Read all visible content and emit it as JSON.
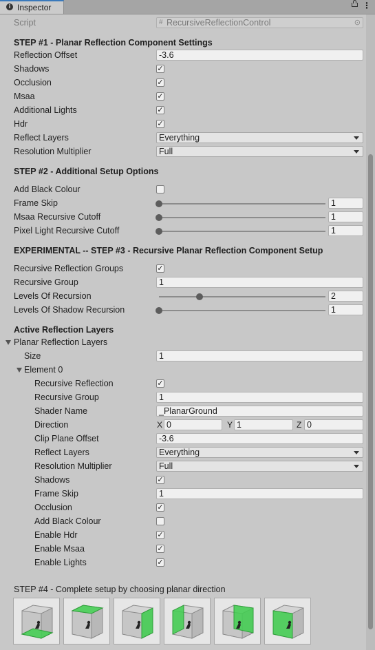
{
  "window": {
    "tab_title": "Inspector"
  },
  "script": {
    "label": "Script",
    "value": "RecursiveReflectionControl"
  },
  "step1": {
    "title": "STEP #1 - Planar Reflection Component Settings",
    "reflection_offset": {
      "label": "Reflection Offset",
      "value": "-3.6"
    },
    "shadows": {
      "label": "Shadows",
      "checked": true
    },
    "occlusion": {
      "label": "Occlusion",
      "checked": true
    },
    "msaa": {
      "label": "Msaa",
      "checked": true
    },
    "additional_lights": {
      "label": "Additional Lights",
      "checked": true
    },
    "hdr": {
      "label": "Hdr",
      "checked": true
    },
    "reflect_layers": {
      "label": "Reflect Layers",
      "value": "Everything"
    },
    "resolution_multiplier": {
      "label": "Resolution Multiplier",
      "value": "Full"
    }
  },
  "step2": {
    "title": "STEP #2 - Additional Setup Options",
    "add_black_colour": {
      "label": "Add Black Colour",
      "checked": false
    },
    "frame_skip": {
      "label": "Frame Skip",
      "value": "1"
    },
    "msaa_recursive_cutoff": {
      "label": "Msaa Recursive Cutoff",
      "value": "1"
    },
    "pixel_light_recursive_cutoff": {
      "label": "Pixel Light Recursive Cutoff",
      "value": "1"
    }
  },
  "step3": {
    "title": "EXPERIMENTAL -- STEP #3 - Recursive Planar Reflection Component Setup",
    "recursive_reflection_groups": {
      "label": "Recursive Reflection Groups",
      "checked": true
    },
    "recursive_group": {
      "label": "Recursive Group",
      "value": "1"
    },
    "levels_of_recursion": {
      "label": "Levels Of Recursion",
      "value": "2"
    },
    "levels_of_shadow_recursion": {
      "label": "Levels Of Shadow Recursion",
      "value": "1"
    }
  },
  "active_layers": {
    "title": "Active Reflection Layers",
    "planar_reflection_layers": "Planar Reflection Layers",
    "size": {
      "label": "Size",
      "value": "1"
    },
    "element0": {
      "label": "Element 0",
      "recursive_reflection": {
        "label": "Recursive Reflection",
        "checked": true
      },
      "recursive_group": {
        "label": "Recursive Group",
        "value": "1"
      },
      "shader_name": {
        "label": "Shader Name",
        "value": "_PlanarGround"
      },
      "direction": {
        "label": "Direction",
        "x_label": "X",
        "x": "0",
        "y_label": "Y",
        "y": "1",
        "z_label": "Z",
        "z": "0"
      },
      "clip_plane_offset": {
        "label": "Clip Plane Offset",
        "value": "-3.6"
      },
      "reflect_layers": {
        "label": "Reflect Layers",
        "value": "Everything"
      },
      "resolution_multiplier": {
        "label": "Resolution Multiplier",
        "value": "Full"
      },
      "shadows": {
        "label": "Shadows",
        "checked": true
      },
      "frame_skip": {
        "label": "Frame Skip",
        "value": "1"
      },
      "occlusion": {
        "label": "Occlusion",
        "checked": true
      },
      "add_black_colour": {
        "label": "Add Black Colour",
        "checked": false
      },
      "enable_hdr": {
        "label": "Enable Hdr",
        "checked": true
      },
      "enable_msaa": {
        "label": "Enable Msaa",
        "checked": true
      },
      "enable_lights": {
        "label": "Enable Lights",
        "checked": true
      }
    }
  },
  "step4": {
    "title": "STEP #4 - Complete setup by choosing planar direction",
    "directions": [
      "floor",
      "top",
      "right",
      "left",
      "back",
      "front"
    ]
  },
  "colors": {
    "highlight_green": "#3fcf4f",
    "tab_accent": "#3a79bb"
  },
  "sliders": {
    "frame_skip": {
      "min": 1,
      "max": 10,
      "value": 1
    },
    "msaa_recursive_cutoff": {
      "min": 1,
      "max": 10,
      "value": 1
    },
    "pixel_light_recursive_cutoff": {
      "min": 1,
      "max": 10,
      "value": 1
    },
    "levels_of_recursion": {
      "min": 1,
      "max": 6,
      "value": 2
    },
    "levels_of_shadow_recursion": {
      "min": 1,
      "max": 10,
      "value": 1
    }
  }
}
